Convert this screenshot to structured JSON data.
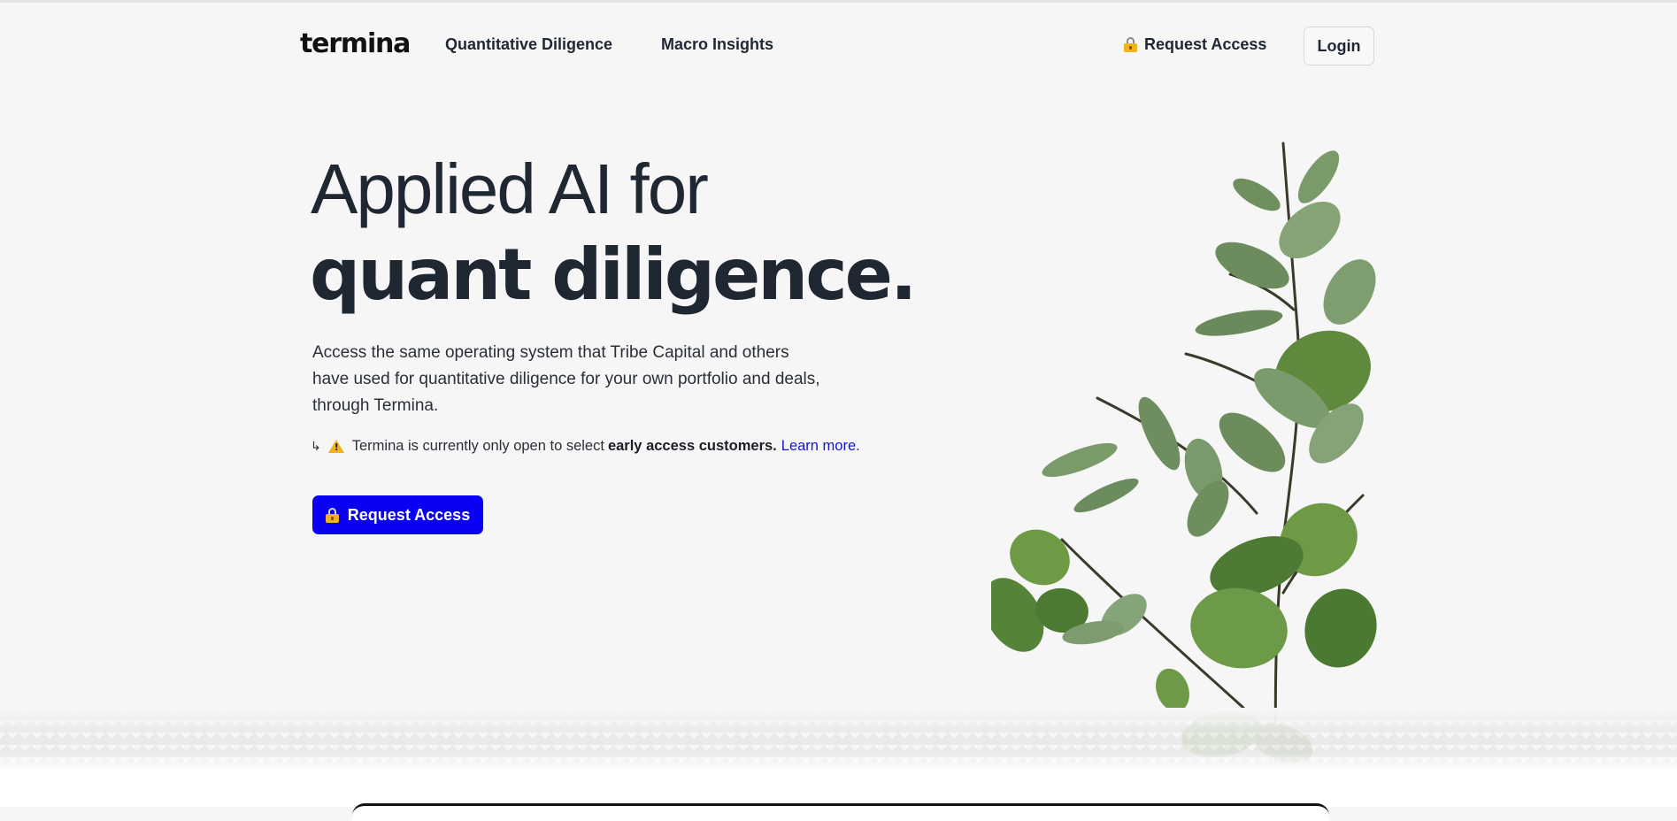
{
  "header": {
    "logo": "termina",
    "nav": [
      {
        "label": "Quantitative Diligence"
      },
      {
        "label": "Macro Insights"
      }
    ],
    "request_access": "Request Access",
    "login": "Login"
  },
  "hero": {
    "line1": "Applied AI for",
    "line2": "quant diligence.",
    "description": "Access the same operating system that Tribe Capital and others have used for quantitative diligence for your own portfolio and deals, through Termina.",
    "notice": {
      "arrow": "↳",
      "text": "Termina is currently only open to select",
      "bold": "early access customers.",
      "link": "Learn more."
    },
    "cta": "Request Access"
  },
  "icons": {
    "lock": "lock-icon",
    "warning": "warning-icon",
    "plant": "eucalyptus-branch-image"
  },
  "colors": {
    "accent": "#0a00f4",
    "link": "#1515d0",
    "text": "#1f2733",
    "background": "#f6f6f6"
  }
}
